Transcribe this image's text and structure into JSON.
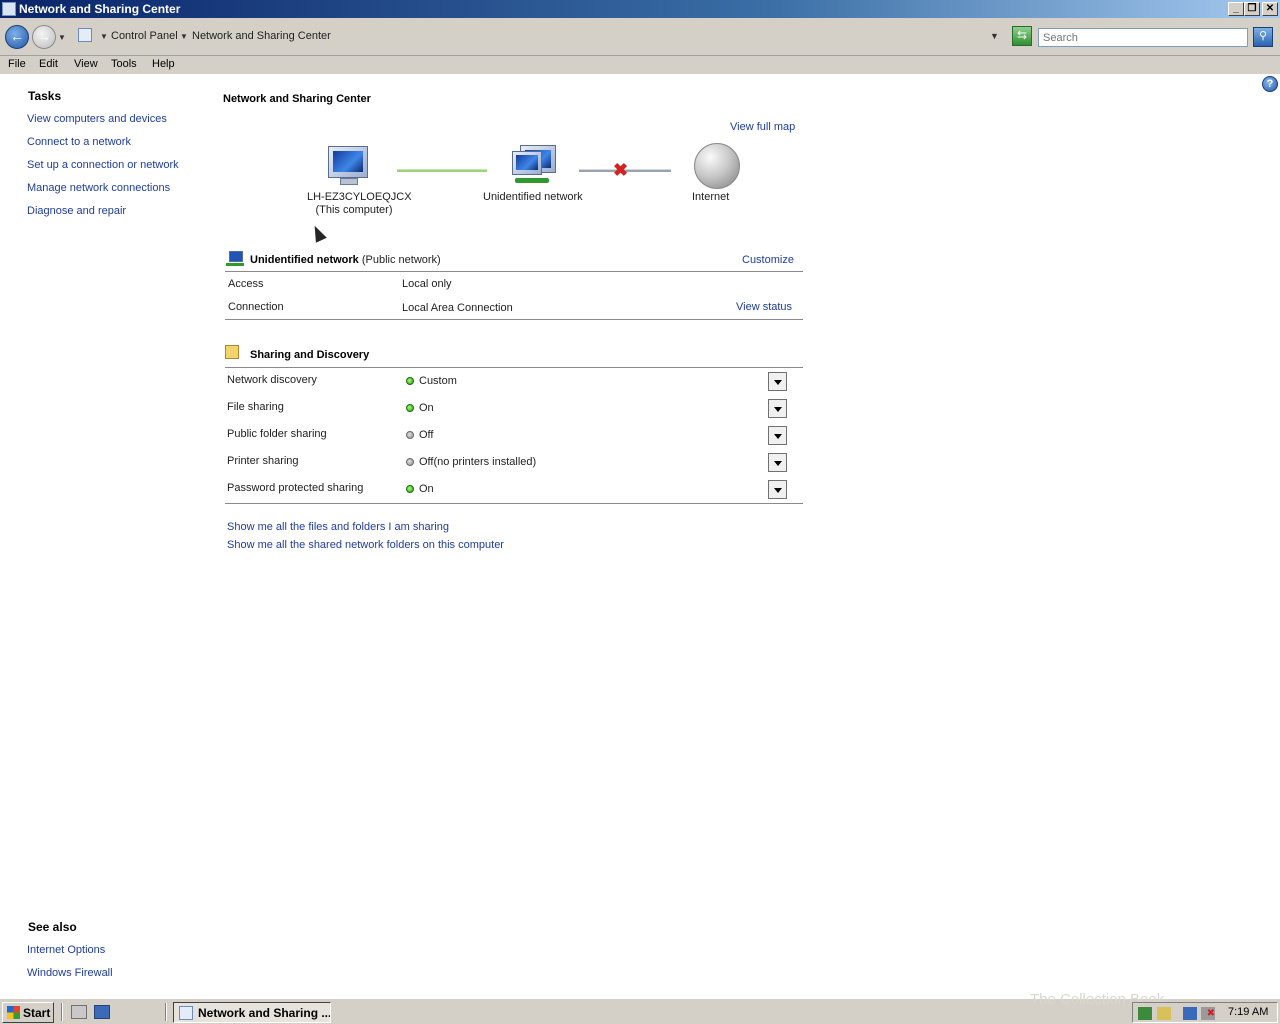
{
  "window": {
    "title": "Network and Sharing Center"
  },
  "address": {
    "breadcrumbs": [
      "Control Panel",
      "Network and Sharing Center"
    ],
    "search_placeholder": "Search"
  },
  "menu": [
    "File",
    "Edit",
    "View",
    "Tools",
    "Help"
  ],
  "left_pane": {
    "tasks_heading": "Tasks",
    "tasks": [
      "View computers and devices",
      "Connect to a network",
      "Set up a connection or network",
      "Manage network connections",
      "Diagnose and repair"
    ],
    "see_also_heading": "See also",
    "see_also": [
      "Internet Options",
      "Windows Firewall"
    ]
  },
  "main": {
    "title": "Network and Sharing Center",
    "view_full_map": "View full map",
    "map": {
      "computer_name": "LH-EZ3CYLOEQJCX",
      "computer_sub": "(This computer)",
      "network": "Unidentified network",
      "internet": "Internet"
    },
    "network_section": {
      "name": "Unidentified network",
      "type": "(Public network)",
      "customize": "Customize",
      "rows": [
        {
          "label": "Access",
          "value": "Local only",
          "action": ""
        },
        {
          "label": "Connection",
          "value": "Local Area Connection",
          "action": "View status"
        }
      ]
    },
    "sharing": {
      "heading": "Sharing and Discovery",
      "rows": [
        {
          "label": "Network discovery",
          "status": "Custom",
          "indicator": "green"
        },
        {
          "label": "File sharing",
          "status": "On",
          "indicator": "green"
        },
        {
          "label": "Public folder sharing",
          "status": "Off",
          "indicator": "gray"
        },
        {
          "label": "Printer sharing",
          "status": "Off(no printers installed)",
          "indicator": "gray"
        },
        {
          "label": "Password protected sharing",
          "status": "On",
          "indicator": "green"
        }
      ]
    },
    "links": [
      "Show me all the files and folders I am sharing",
      "Show me all the shared network folders on this computer"
    ]
  },
  "taskbar": {
    "start": "Start",
    "task_button": "Network and Sharing ...",
    "clock": "7:19 AM",
    "watermark": "The Collection Book"
  }
}
